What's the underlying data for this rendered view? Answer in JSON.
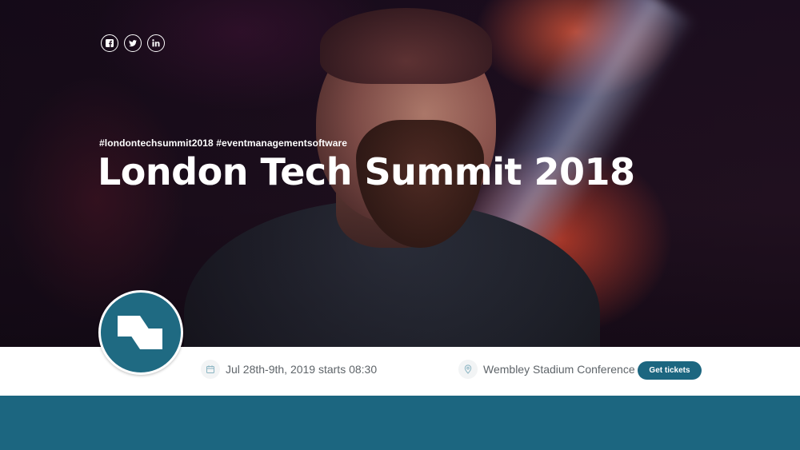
{
  "hero": {
    "hashtags": "#londontechsummit2018 #eventmanagementsoftware",
    "title": "London Tech Summit 2018"
  },
  "social": {
    "items": [
      {
        "icon": "facebook-icon"
      },
      {
        "icon": "twitter-icon"
      },
      {
        "icon": "linkedin-icon"
      }
    ]
  },
  "event": {
    "date": "Jul 28th-9th, 2019 starts 08:30",
    "date_icon": "calendar-icon",
    "venue": "Wembley Stadium Conference",
    "venue_icon": "location-pin-icon",
    "cta_label": "Get tickets"
  },
  "colors": {
    "brand": "#1c6680",
    "logo": "#1f6a82",
    "text_muted": "#5e6469",
    "white": "#ffffff"
  }
}
